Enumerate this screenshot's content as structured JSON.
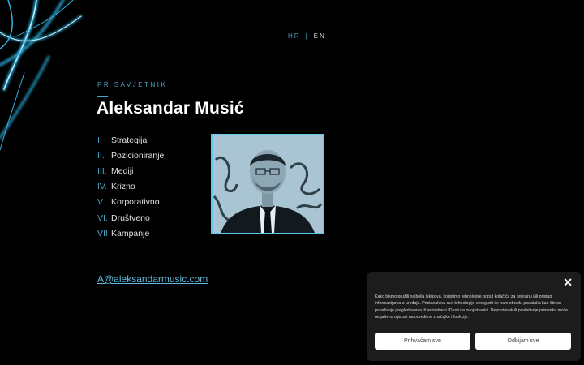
{
  "lang": {
    "hr": "HR",
    "separator": "|",
    "en": "EN"
  },
  "header": {
    "role": "PR SAVJETNIK",
    "name": "Aleksandar Musić"
  },
  "menu": [
    {
      "num": "I.",
      "label": "Strategija"
    },
    {
      "num": "II.",
      "label": "Pozicioniranje"
    },
    {
      "num": "III.",
      "label": "Mediji"
    },
    {
      "num": "IV.",
      "label": "Krizno"
    },
    {
      "num": "V.",
      "label": "Korporativno"
    },
    {
      "num": "VI.",
      "label": "Društveno"
    },
    {
      "num": "VII.",
      "label": "Kampanje"
    }
  ],
  "contact": {
    "email": "A@aleksandarmusic.com"
  },
  "cookie": {
    "close": "✕",
    "text": "Kako bismo pružili najbolja iskustva, koristimo tehnologije poput kolačića za pohranu i/ili pristup informacijama o uređaju. Pristanak na ove tehnologije omogućit će nam obradu podataka kao što su ponašanje pregledavanja ili jedinstveni ID-ovi na ovoj stranici. Nepristanak ili povlačenje pristanka može negativno utjecati na određene značajke i funkcije.",
    "accept": "Prihvaćam sve",
    "reject": "Odbijam sve"
  },
  "colors": {
    "accent": "#49a6c8",
    "photo_border": "#5bc7ea",
    "background": "#000000"
  }
}
